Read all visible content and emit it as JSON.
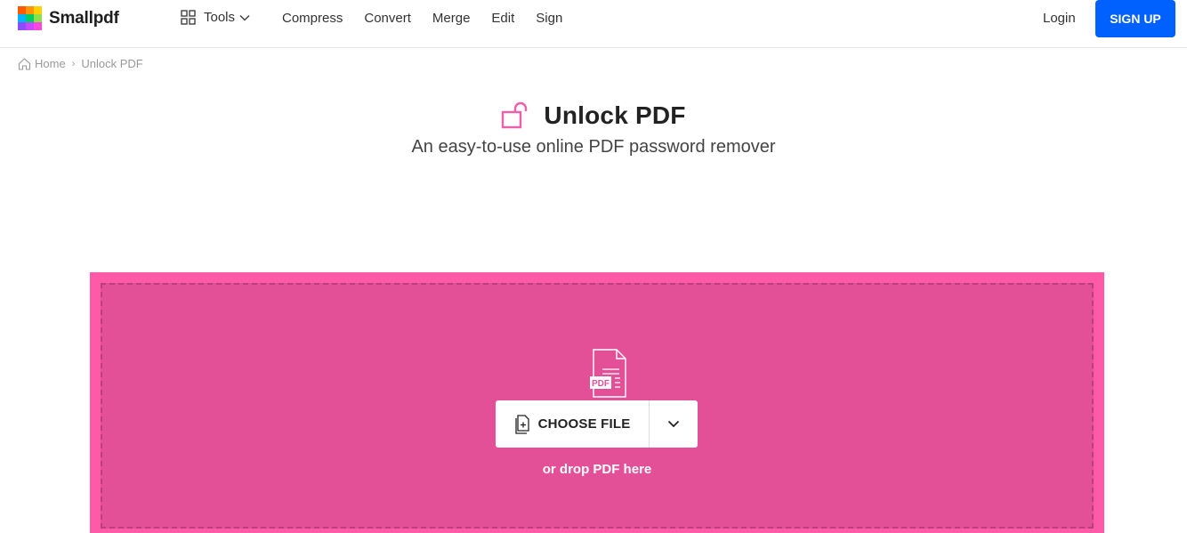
{
  "brand": {
    "name": "Smallpdf",
    "logo_colors": [
      "#ff5a00",
      "#ff9500",
      "#ffd000",
      "#00b4ff",
      "#00cc66",
      "#8ce04a",
      "#8c4cff",
      "#c847ff",
      "#ff47e0"
    ]
  },
  "header": {
    "tools_label": "Tools",
    "nav": [
      "Compress",
      "Convert",
      "Merge",
      "Edit",
      "Sign"
    ],
    "login_label": "Login",
    "signup_label": "SIGN UP"
  },
  "breadcrumb": {
    "home": "Home",
    "separator": "›",
    "current": "Unlock PDF"
  },
  "hero": {
    "title": "Unlock PDF",
    "subtitle": "An easy-to-use online PDF password remover",
    "icon": "unlock-icon"
  },
  "dropzone": {
    "file_badge": "PDF",
    "choose_label": "CHOOSE FILE",
    "drop_hint": "or drop PDF here"
  },
  "colors": {
    "accent": "#ff5aa8",
    "dropzone_bg": "#e45098",
    "signup_bg": "#0061fe"
  }
}
